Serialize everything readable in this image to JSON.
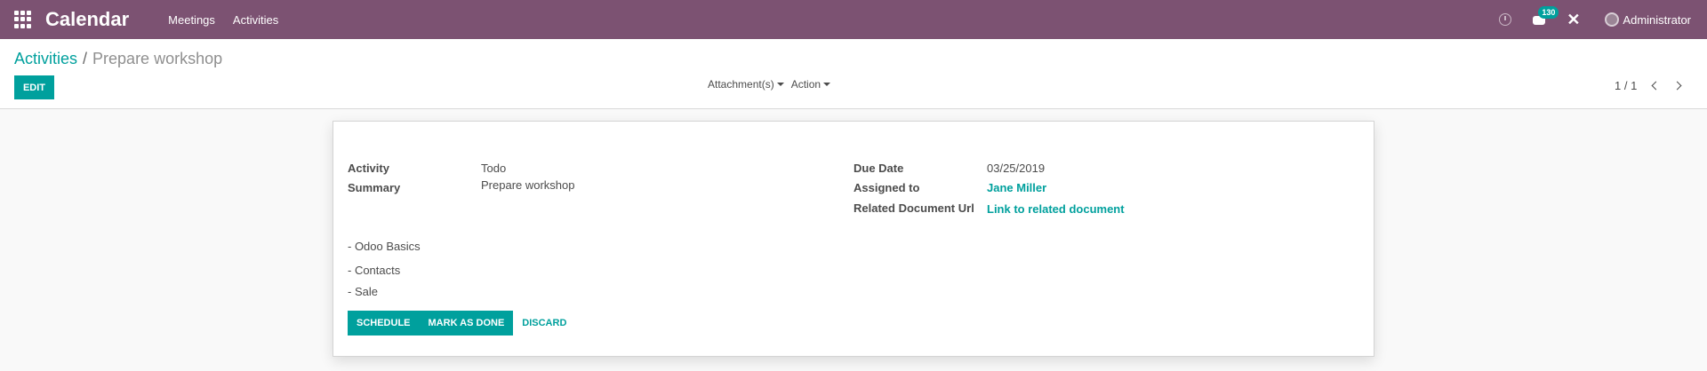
{
  "navbar": {
    "brand": "Calendar",
    "menu": [
      {
        "label": "Meetings"
      },
      {
        "label": "Activities"
      }
    ],
    "chat_badge": "130",
    "user_name": "Administrator",
    "icons": {
      "apps": "apps-grid-icon",
      "activity": "clock-icon",
      "chat": "chat-icon",
      "tools": "tools-icon",
      "avatar": "avatar"
    }
  },
  "control_panel": {
    "breadcrumb": {
      "parent": "Activities",
      "separator": "/",
      "current": "Prepare workshop"
    },
    "edit_label": "EDIT",
    "attachments_label": "Attachment(s)",
    "action_label": "Action",
    "pager_value": "1 / 1"
  },
  "form": {
    "left_fields": [
      {
        "label": "Activity",
        "value": "Todo"
      },
      {
        "label": "Summary",
        "value": "Prepare workshop"
      }
    ],
    "right_fields": [
      {
        "label": "Due Date",
        "value": "03/25/2019"
      },
      {
        "label": "Assigned to",
        "value": "Jane Miller"
      },
      {
        "label": "Related Document Url",
        "value": "Link to related document"
      }
    ],
    "note_lines": [
      "- Odoo Basics",
      "- Contacts",
      "- Sale"
    ],
    "buttons": {
      "schedule": "SCHEDULE",
      "mark_done": "MARK AS DONE",
      "discard": "DISCARD"
    }
  },
  "colors": {
    "navbar": "#7c5272",
    "accent": "#00a09d"
  }
}
